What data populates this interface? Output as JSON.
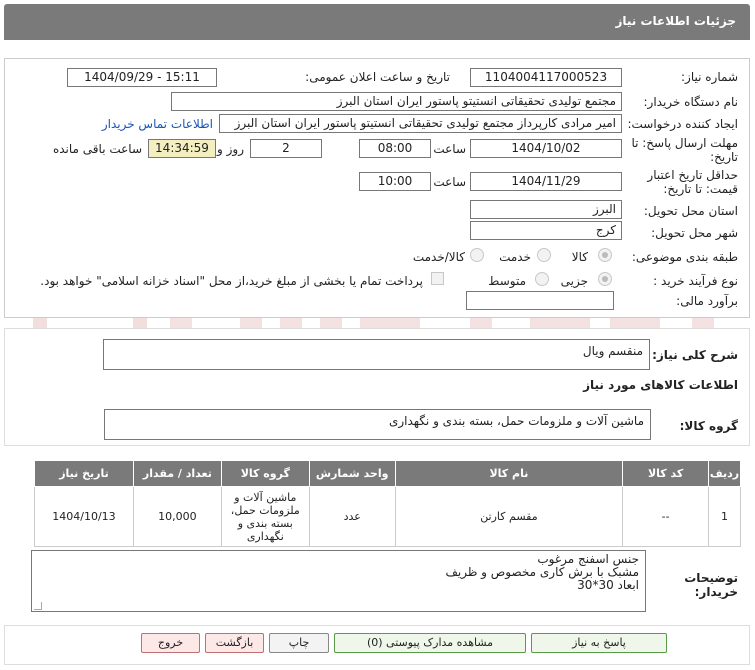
{
  "header": {
    "title": "جزئیات اطلاعات نیاز"
  },
  "fields": {
    "need_number_label": "شماره نیاز:",
    "need_number": "1104004117000523",
    "announce_label": "تاریخ و ساعت اعلان عمومی:",
    "announce_value": "1404/09/29 - 15:11",
    "buyer_label": "نام دستگاه خریدار:",
    "buyer_value": "مجتمع تولیدی تحقیقاتی انستیتو پاستور ایران استان البرز",
    "creator_label": "ایجاد کننده درخواست:",
    "creator_value": "امیر مرادی کارپرداز مجتمع تولیدی تحقیقاتی انستیتو پاستور ایران استان البرز",
    "contact_link": "اطلاعات تماس خریدار",
    "deadline_label_1": "مهلت ارسال پاسخ: تا",
    "deadline_label_2": "تاریخ:",
    "deadline_date": "1404/10/02",
    "time_label": "ساعت",
    "deadline_time": "08:00",
    "days_value": "2",
    "days_label": "روز و",
    "remaining_value": "14:34:59",
    "remaining_label": "ساعت باقی مانده",
    "validity_label_1": "حداقل تاریخ اعتبار",
    "validity_label_2": "قیمت: تا تاریخ:",
    "validity_date": "1404/11/29",
    "validity_time": "10:00",
    "province_label": "استان محل تحویل:",
    "province_value": "البرز",
    "city_label": "شهر محل تحویل:",
    "city_value": "کرج",
    "category_label": "طبقه بندی موضوعی:",
    "category_options": [
      "کالا",
      "خدمت",
      "کالا/خدمت"
    ],
    "process_label": "نوع فرآیند خرید :",
    "process_options": [
      "جزیی",
      "متوسط"
    ],
    "payment_note": "پرداخت تمام یا بخشی از مبلغ خرید،از محل \"اسناد خزانه اسلامی\" خواهد بود.",
    "estimate_label": "برآورد مالی:",
    "estimate_value": ""
  },
  "summary": {
    "label": "شرح کلی نیاز:",
    "value": "منقسم ویال"
  },
  "goods_section_title": "اطلاعات کالاهای مورد نیاز",
  "goods_group": {
    "label": "گروه کالا:",
    "value": "ماشین آلات و ملزومات حمل، بسته بندی و نگهداری"
  },
  "table": {
    "headers": [
      "ردیف",
      "کد کالا",
      "نام کالا",
      "واحد شمارش",
      "گروه کالا",
      "تعداد / مقدار",
      "تاریخ نیاز"
    ],
    "rows": [
      {
        "index": "1",
        "code": "--",
        "name": "مقسم کارتن",
        "unit": "عدد",
        "group": "ماشین آلات و ملزومات حمل، بسته بندی و نگهداری",
        "qty": "10,000",
        "date": "1404/10/13"
      }
    ]
  },
  "buyer_notes": {
    "label_1": "توضیحات",
    "label_2": "خریدار:",
    "lines": [
      "جنس اسفنج مرغوب",
      "مشبک با برش کاری مخصوص و ظریف",
      "ابعاد 30*30"
    ]
  },
  "buttons": {
    "reply": "پاسخ به نیاز",
    "attachments": "مشاهده مدارک پیوستی (0)",
    "print": "چاپ",
    "back": "بازگشت",
    "exit": "خروج"
  }
}
